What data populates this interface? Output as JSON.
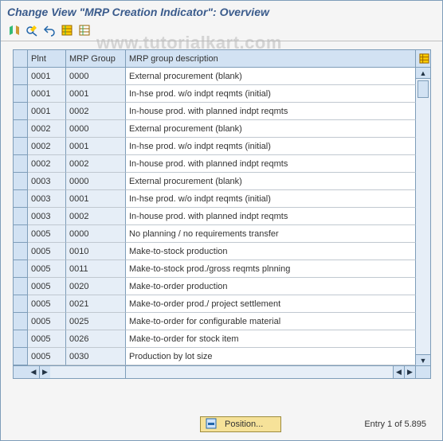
{
  "title": "Change View \"MRP Creation Indicator\": Overview",
  "watermark": "www.tutorialkart.com",
  "columns": {
    "plnt": "Plnt",
    "mrp_group": "MRP Group",
    "mrp_group_desc": "MRP group description"
  },
  "rows": [
    {
      "plnt": "0001",
      "grp": "0000",
      "desc": "External procurement              (blank)"
    },
    {
      "plnt": "0001",
      "grp": "0001",
      "desc": "In-hse prod. w/o indpt reqmts (initial)"
    },
    {
      "plnt": "0001",
      "grp": "0002",
      "desc": "In-house prod. with planned indpt reqmts"
    },
    {
      "plnt": "0002",
      "grp": "0000",
      "desc": "External procurement              (blank)"
    },
    {
      "plnt": "0002",
      "grp": "0001",
      "desc": "In-hse prod. w/o indpt reqmts (initial)"
    },
    {
      "plnt": "0002",
      "grp": "0002",
      "desc": "In-house prod. with planned indpt reqmts"
    },
    {
      "plnt": "0003",
      "grp": "0000",
      "desc": "External procurement              (blank)"
    },
    {
      "plnt": "0003",
      "grp": "0001",
      "desc": "In-hse prod. w/o indpt reqmts (initial)"
    },
    {
      "plnt": "0003",
      "grp": "0002",
      "desc": "In-house prod. with planned indpt reqmts"
    },
    {
      "plnt": "0005",
      "grp": "0000",
      "desc": "No planning / no requirements transfer"
    },
    {
      "plnt": "0005",
      "grp": "0010",
      "desc": "Make-to-stock production"
    },
    {
      "plnt": "0005",
      "grp": "0011",
      "desc": "Make-to-stock prod./gross reqmts plnning"
    },
    {
      "plnt": "0005",
      "grp": "0020",
      "desc": "Make-to-order production"
    },
    {
      "plnt": "0005",
      "grp": "0021",
      "desc": "Make-to-order prod./ project settlement"
    },
    {
      "plnt": "0005",
      "grp": "0025",
      "desc": "Make-to-order for configurable material"
    },
    {
      "plnt": "0005",
      "grp": "0026",
      "desc": "Make-to-order for stock item"
    },
    {
      "plnt": "0005",
      "grp": "0030",
      "desc": "Production by lot size"
    }
  ],
  "footer": {
    "position_label": "Position...",
    "entry_text": "Entry 1 of 5.895"
  }
}
